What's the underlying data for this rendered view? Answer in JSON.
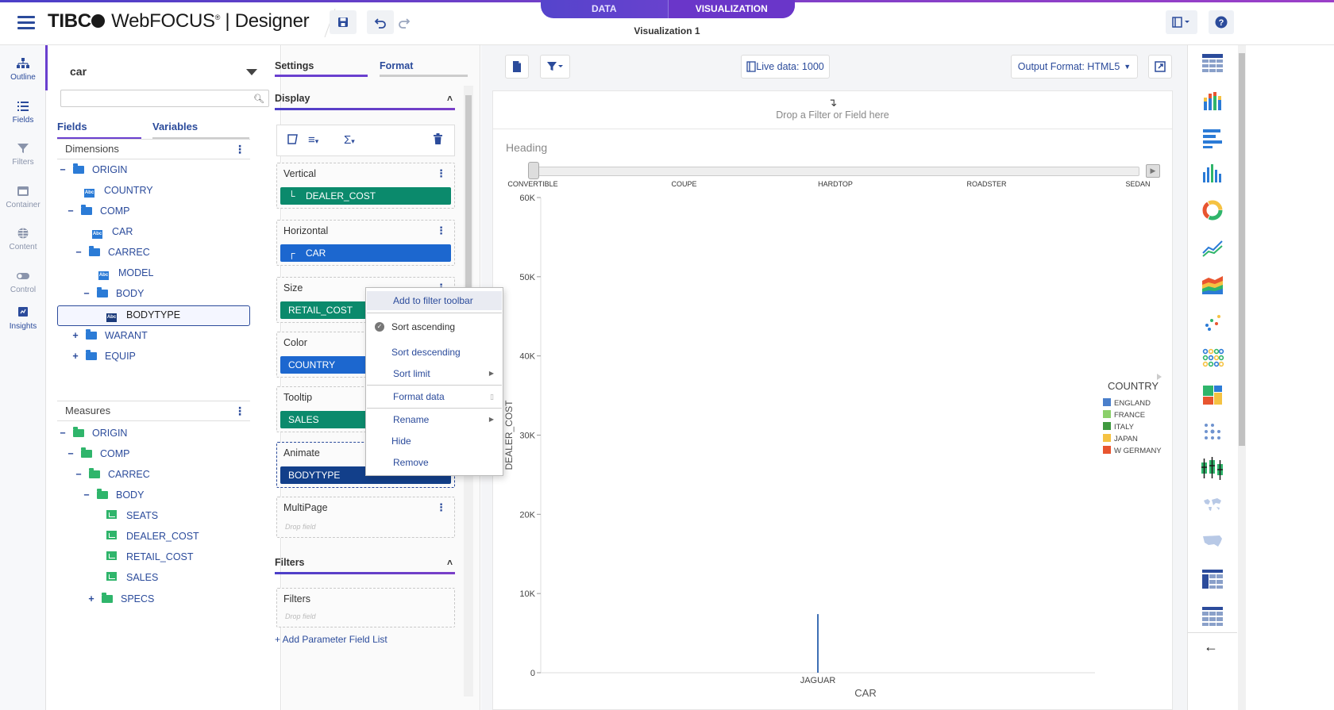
{
  "app": {
    "brand_left": "TIBC",
    "brand_right": " WebFOCUS",
    "brand_reg": "®",
    "brand_suffix": " | Designer",
    "mode_tabs": [
      "DATA",
      "VISUALIZATION"
    ],
    "active_mode": "VISUALIZATION",
    "viz_title": "Visualization 1",
    "accent": "#6a3fcf",
    "link_color": "#2b4b9b"
  },
  "rail": {
    "items": [
      {
        "label": "Outline",
        "icon": "outline-icon"
      },
      {
        "label": "Fields",
        "icon": "fields-icon"
      },
      {
        "label": "Filters",
        "icon": "filter-icon"
      },
      {
        "label": "Container",
        "icon": "container-icon"
      },
      {
        "label": "Content",
        "icon": "globe-icon"
      },
      {
        "label": "Control",
        "icon": "toggle-icon"
      },
      {
        "label": "Insights",
        "icon": "insights-icon"
      }
    ],
    "active": "Fields"
  },
  "fields_panel": {
    "datasource": "car",
    "search_placeholder": "",
    "tabs": [
      "Fields",
      "Variables"
    ],
    "active_tab": "Fields",
    "dimensions_label": "Dimensions",
    "measures_label": "Measures",
    "dimensions": [
      {
        "toggle": "−",
        "type": "folder",
        "label": "ORIGIN"
      },
      {
        "toggle": "",
        "type": "abc",
        "label": "COUNTRY"
      },
      {
        "toggle": "−",
        "type": "folder",
        "label": "COMP"
      },
      {
        "toggle": "",
        "type": "abc",
        "label": "CAR"
      },
      {
        "toggle": "−",
        "type": "folder",
        "label": "CARREC"
      },
      {
        "toggle": "",
        "type": "abc",
        "label": "MODEL"
      },
      {
        "toggle": "−",
        "type": "folder",
        "label": "BODY"
      },
      {
        "toggle": "",
        "type": "abc",
        "label": "BODYTYPE",
        "selected": true
      },
      {
        "toggle": "+",
        "type": "folder",
        "label": "WARANT"
      },
      {
        "toggle": "+",
        "type": "folder",
        "label": "EQUIP"
      }
    ],
    "measures": [
      {
        "toggle": "−",
        "type": "folder",
        "label": "ORIGIN"
      },
      {
        "toggle": "−",
        "type": "folder",
        "label": "COMP"
      },
      {
        "toggle": "−",
        "type": "folder",
        "label": "CARREC"
      },
      {
        "toggle": "−",
        "type": "folder",
        "label": "BODY"
      },
      {
        "toggle": "",
        "type": "measure",
        "label": "SEATS"
      },
      {
        "toggle": "",
        "type": "measure",
        "label": "DEALER_COST"
      },
      {
        "toggle": "",
        "type": "measure",
        "label": "RETAIL_COST"
      },
      {
        "toggle": "",
        "type": "measure",
        "label": "SALES"
      },
      {
        "toggle": "+",
        "type": "folder",
        "label": "SPECS"
      }
    ]
  },
  "settings_panel": {
    "tabs": [
      "Settings",
      "Format"
    ],
    "active_tab": "Settings",
    "display_header": "Display",
    "filters_header": "Filters",
    "buckets": [
      {
        "name": "Vertical",
        "field": "DEALER_COST",
        "color": "teal"
      },
      {
        "name": "Horizontal",
        "field": "CAR",
        "color": "blue"
      },
      {
        "name": "Size",
        "field": "RETAIL_COST",
        "color": "teal"
      },
      {
        "name": "Color",
        "field": "COUNTRY",
        "color": "blue"
      },
      {
        "name": "Tooltip",
        "field": "SALES",
        "color": "teal"
      },
      {
        "name": "Animate",
        "field": "BODYTYPE",
        "color": "navy"
      },
      {
        "name": "MultiPage",
        "field": "",
        "drop": "Drop field"
      }
    ],
    "filters_bucket": {
      "name": "Filters",
      "drop": "Drop field"
    },
    "add_param": "+ Add Parameter Field List"
  },
  "context_menu": {
    "items": [
      {
        "label": "Add to filter toolbar",
        "highlight": true
      },
      {
        "label": "Sort ascending",
        "checked": true
      },
      {
        "label": "Sort descending"
      },
      {
        "label": "Sort limit",
        "submenu": true
      },
      {
        "label": "Format data",
        "submenu": true
      },
      {
        "label": "Rename",
        "submenu": true
      },
      {
        "label": "Hide"
      },
      {
        "label": "Remove"
      }
    ]
  },
  "canvas": {
    "live_data": "Live data: 1000",
    "output_format": "Output Format: HTML5",
    "drop_hint": "Drop a Filter or Field here",
    "heading": "Heading",
    "animate_steps": [
      "CONVERTIBLE",
      "COUPE",
      "HARDTOP",
      "ROADSTER",
      "SEDAN"
    ]
  },
  "chart_data": {
    "type": "bar",
    "categories": [
      "JAGUAR"
    ],
    "series": [
      {
        "name": "ENGLAND",
        "values": [
          7400
        ]
      }
    ],
    "xlabel": "CAR",
    "ylabel": "DEALER_COST",
    "ylim": [
      0,
      60000
    ],
    "yticks": [
      0,
      10000,
      20000,
      30000,
      40000,
      50000,
      60000
    ],
    "yticklabels": [
      "0",
      "10K",
      "20K",
      "30K",
      "40K",
      "50K",
      "60K"
    ],
    "legend": {
      "title": "COUNTRY",
      "placement": "right",
      "entries": [
        {
          "label": "ENGLAND",
          "color": "#4a7fcb"
        },
        {
          "label": "FRANCE",
          "color": "#8bd06a"
        },
        {
          "label": "ITALY",
          "color": "#3f9a3f"
        },
        {
          "label": "JAPAN",
          "color": "#f5c242"
        },
        {
          "label": "W GERMANY",
          "color": "#e8552f"
        }
      ]
    },
    "bar_color": "#3e6fb4"
  }
}
